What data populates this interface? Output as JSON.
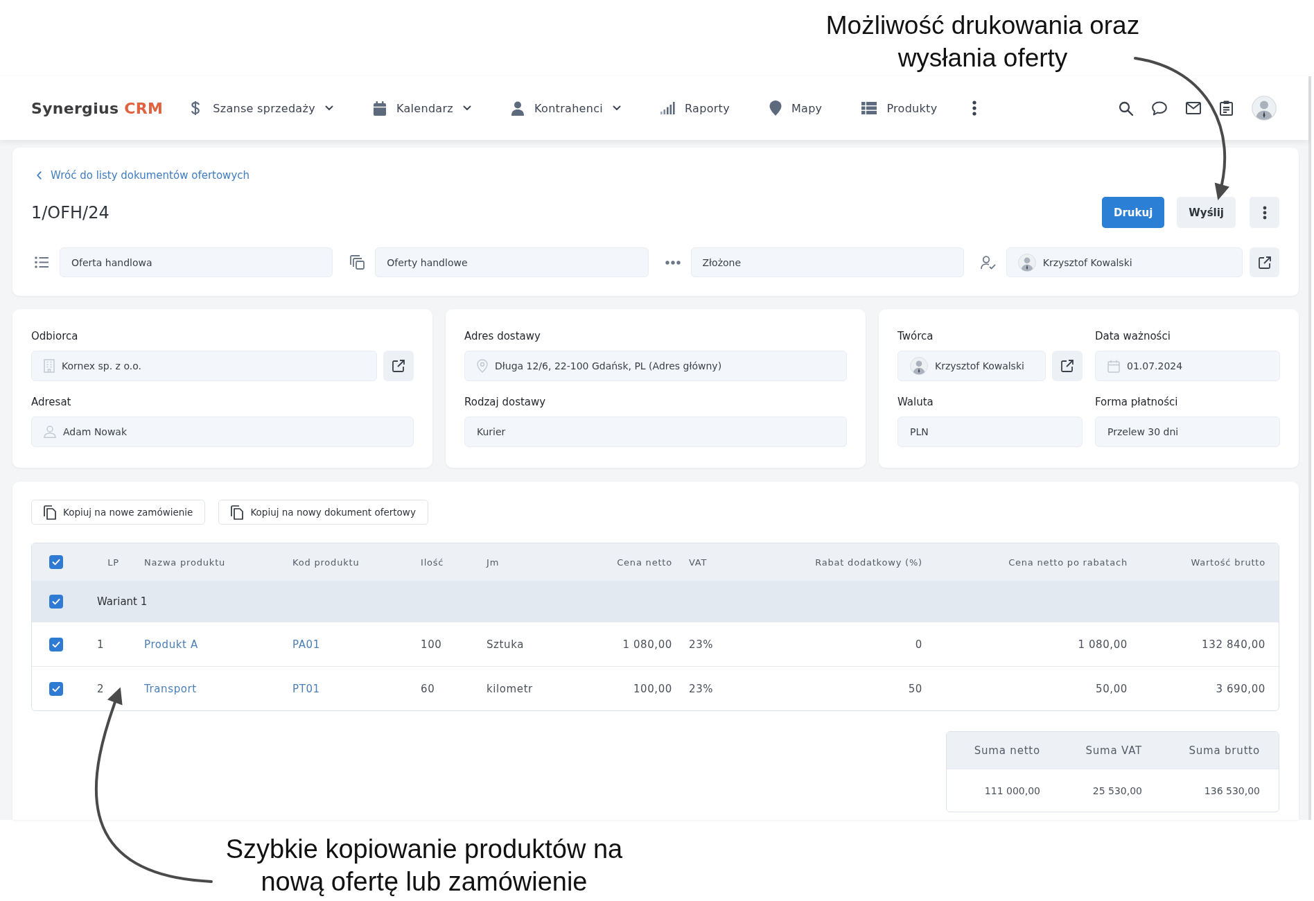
{
  "annotations": {
    "top": "Możliwość drukowania oraz\nwysłania oferty",
    "bottom": "Szybkie kopiowanie produktów na\nnową ofertę lub zamówienie"
  },
  "nav": {
    "logo": {
      "name": "Synergius",
      "accent": "CRM"
    },
    "items": [
      {
        "label": "Szanse sprzedaży",
        "dropdown": true
      },
      {
        "label": "Kalendarz",
        "dropdown": true
      },
      {
        "label": "Kontrahenci",
        "dropdown": true
      },
      {
        "label": "Raporty",
        "dropdown": false
      },
      {
        "label": "Mapy",
        "dropdown": false
      },
      {
        "label": "Produkty",
        "dropdown": false
      }
    ]
  },
  "document": {
    "back_link": "Wróć do listy dokumentów ofertowych",
    "title": "1/OFH/24",
    "actions": [
      {
        "label": "Drukuj",
        "primary": true
      },
      {
        "label": "Wyślij",
        "primary": false
      }
    ],
    "fields": [
      {
        "value": "Oferta handlowa",
        "kind": "text",
        "link": false
      },
      {
        "value": "Oferty handlowe",
        "kind": "text",
        "link": false
      },
      {
        "value": "Złożone",
        "kind": "text",
        "link": false
      },
      {
        "value": "Krzysztof Kowalski",
        "kind": "user",
        "link": true
      }
    ]
  },
  "cards": [
    {
      "fields": [
        {
          "label": "Odbiorca",
          "value": "Kornex sp. z o.o.",
          "kind": "company",
          "link": true
        },
        {
          "label": "Adresat",
          "value": "Adam Nowak",
          "kind": "contact",
          "link": false
        }
      ]
    },
    {
      "fields": [
        {
          "label": "Adres dostawy",
          "value": "Długa 12/6, 22-100 Gdańsk, PL (Adres główny)",
          "kind": "address",
          "link": false
        },
        {
          "label": "Rodzaj dostawy",
          "value": "Kurier",
          "kind": "text",
          "link": false
        }
      ]
    },
    {
      "fields": [
        {
          "label": "Twórca",
          "value": "Krzysztof Kowalski",
          "kind": "user",
          "link": true
        },
        {
          "label": "Data ważności",
          "value": "01.07.2024",
          "kind": "date",
          "link": false
        },
        {
          "label": "Waluta",
          "value": "PLN",
          "kind": "text",
          "link": false
        },
        {
          "label": "Forma płatności",
          "value": "Przelew 30 dni",
          "kind": "text",
          "link": false
        }
      ]
    }
  ],
  "products": {
    "copy_buttons": [
      "Kopiuj na nowe zamówienie",
      "Kopiuj na nowy dokument ofertowy"
    ],
    "table": {
      "all_checked": true,
      "columns": [
        "LP",
        "Nazwa produktu",
        "Kod produktu",
        "Ilość",
        "Jm",
        "Cena netto",
        "VAT",
        "Rabat dodatkowy (%)",
        "Cena netto po rabatach",
        "Wartość brutto"
      ],
      "groups": [
        {
          "label": "Wariant 1",
          "checked": true,
          "rows": [
            {
              "checked": true,
              "cells": [
                "1",
                "Produkt A",
                "PA01",
                "100",
                "Sztuka",
                "1 080,00",
                "23%",
                "0",
                "1 080,00",
                "132 840,00"
              ]
            },
            {
              "checked": true,
              "cells": [
                "2",
                "Transport",
                "PT01",
                "60",
                "kilometr",
                "100,00",
                "23%",
                "50",
                "50,00",
                "3 690,00"
              ]
            }
          ]
        }
      ]
    },
    "totals": {
      "columns": [
        "Suma netto",
        "Suma VAT",
        "Suma brutto"
      ],
      "values": [
        "111 000,00",
        "25 530,00",
        "136 530,00"
      ]
    }
  }
}
